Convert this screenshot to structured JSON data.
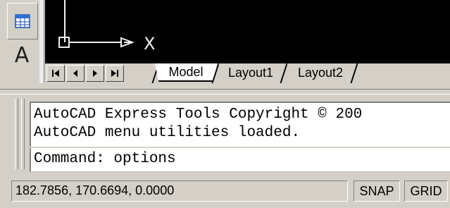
{
  "toolbar": {
    "icons": [
      "table-icon",
      "text-icon"
    ],
    "text_glyph": "A"
  },
  "drawing": {
    "ucs_x_label": "X",
    "background": "#000000"
  },
  "tabs": {
    "nav_buttons": [
      "first",
      "previous",
      "next",
      "last"
    ],
    "items": [
      {
        "label": "Model",
        "active": true
      },
      {
        "label": "Layout1",
        "active": false
      },
      {
        "label": "Layout2",
        "active": false
      }
    ]
  },
  "command": {
    "history": [
      "AutoCAD Express Tools Copyright © 200",
      "AutoCAD menu utilities loaded."
    ],
    "prompt": "Command: options"
  },
  "status": {
    "coordinates": "182.7856, 170.6694, 0.0000",
    "snap_label": "SNAP",
    "grid_label": "GRID"
  }
}
